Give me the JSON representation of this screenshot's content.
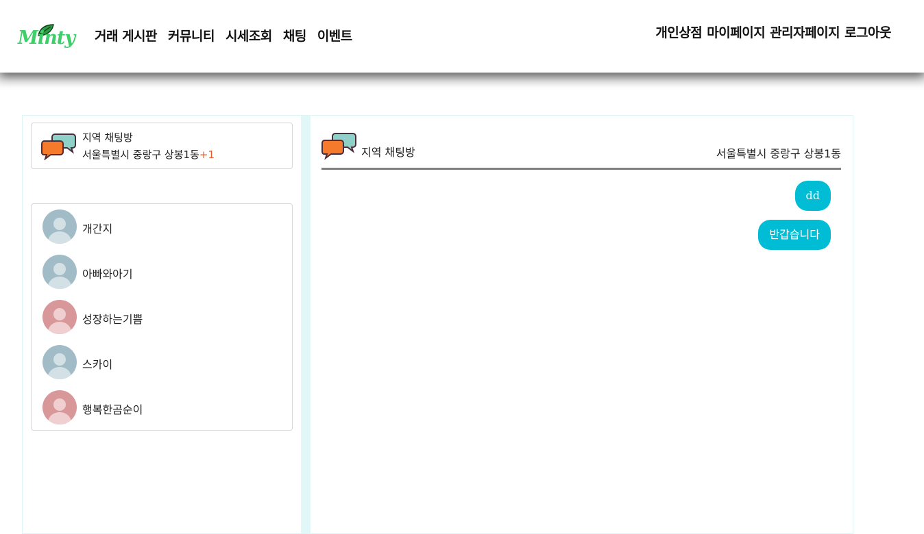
{
  "brand": {
    "logo_text": "Minty"
  },
  "nav": {
    "left": [
      "거래 게시판",
      "커뮤니티",
      "시세조회",
      "채팅",
      "이벤트"
    ],
    "right": [
      "개인상점",
      "마이페이지",
      "관리자페이지",
      "로그아웃"
    ]
  },
  "sidebar": {
    "room": {
      "title": "지역 채팅방",
      "location": "서울특별시 중랑구 상봉1동",
      "extra": "+1"
    },
    "users": [
      {
        "name": "개간지",
        "avatar": "blue"
      },
      {
        "name": "아빠와아기",
        "avatar": "blue"
      },
      {
        "name": "성장하는기쁨",
        "avatar": "pink"
      },
      {
        "name": "스카이",
        "avatar": "blue"
      },
      {
        "name": "행복한곰순이",
        "avatar": "pink"
      }
    ]
  },
  "chat": {
    "title": "지역 채팅방",
    "location": "서울특별시 중랑구 상봉1동",
    "messages": [
      "dd",
      "반갑습니다"
    ]
  },
  "colors": {
    "bubble": "#00bcd4",
    "divider": "#e2f7f8",
    "plus_accent": "#e05a2a",
    "logo_green": "#3ecf6a"
  },
  "icons": [
    "leaf-icon",
    "chat-bubbles-icon",
    "user-avatar-icon"
  ]
}
